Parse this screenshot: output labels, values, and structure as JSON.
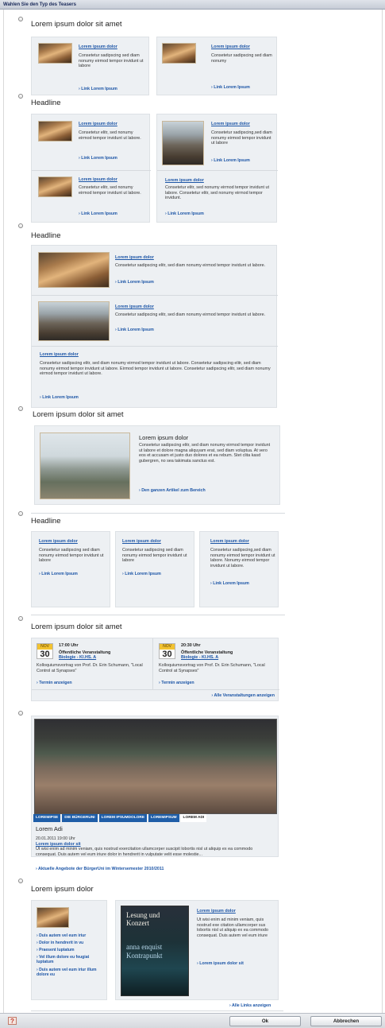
{
  "dialog": {
    "title": "Wahlen Sie den Typ des Teasers",
    "ok_label": "Ok",
    "cancel_label": "Abbrechen",
    "help_label": "?"
  },
  "sections": {
    "s1": {
      "title": "Lorem ipsum dolor sit amet",
      "cards": [
        {
          "link": "Lorem ipsum dolor",
          "text": "Consetetur sadipscing sed diam nonumy eirmod tempor invidunt ut labore",
          "more": "› Link Lorem Ipsum"
        },
        {
          "link": "Lorem ipsum dolor",
          "text": "Consetetur sadipscing sed diam nonumy",
          "more": "› Link Lorem Ipsum"
        }
      ]
    },
    "s2": {
      "title": "Headline",
      "cards": [
        {
          "link": "Lorem ipsum dolor",
          "text": "Consetetur elitr, sed nonumy eirmod tempor invidunt ut labore.",
          "more": "› Link Lorem Ipsum"
        },
        {
          "link": "Lorem ipsum dolor",
          "text": "Consetetur sadipscing,sed diam nonumy eirmod tempor invidunt ut labore",
          "more": "› Link Lorem Ipsum"
        },
        {
          "link": "Lorem ipsum dolor",
          "text": "Consetetur elitr, sed nonumy eirmod tempor invidunt ut labore.",
          "more": "› Link Lorem Ipsum"
        },
        {
          "link": "Lorem ipsum dolor",
          "text": "Consetetur elitr, sed nonumy eirmod tempor invidunt ut labore. Consetetur elitr, sed nonumy eirmod tempor invidunt.",
          "more": "› Link Lorem Ipsum"
        }
      ]
    },
    "s3": {
      "title": "Headline",
      "items": [
        {
          "link": "Lorem ipsum dolor",
          "text": "Consetetur sadipscing elitr, sed diam nonumy eirmod tempor invidunt ut labore.",
          "more": "› Link Lorem Ipsum"
        },
        {
          "link": "Lorem ipsum dolor",
          "text": "Consetetur sadipscing elitr, sed diam nonumy eirmod tempor invidunt ut labore.",
          "more": "› Link Lorem Ipsum"
        },
        {
          "link": "Lorem ipsum dolor",
          "text": "Consetetur sadipscing elitr, sed diam nonumy eirmod tempor invidunt ut labore. Consetetur sadipscing elitr, sed diam nonumy eirmod tempor invidunt ut labore. Eirmod tempor invidunt ut labore. Consetetur sadipscing elitr, sed diam nonumy eirmod tempor invidunt ut labore.",
          "more": "› Link Lorem Ipsum"
        }
      ]
    },
    "s4": {
      "title": "Lorem ipsum dolor sit amet",
      "heading": "Lorem ipsum dolor",
      "text": "Consetetur sadipscing elitr, sed diam nonumy eirmod tempor invidunt ut labore et dolore magna aliquyam erat, sed diam voluptua. At vero eos et accusam et justo duo dolores et ea rebum. Stet clita kasd gubergren, no sea takimata sanctus est.",
      "more": "› Den ganzen Artikel zum Bereich"
    },
    "s5": {
      "title": "Headline",
      "cards": [
        {
          "link": "Lorem ipsum dolor",
          "text": "Consetetur sadipscing sed diam nonumy eirmod tempor invidunt ut labore",
          "more": "› Link Lorem Ipsum"
        },
        {
          "link": "Lorem ipsum dolor",
          "text": "Consetetur sadipscing sed diam nonumy eirmod tempor invidunt ut labore",
          "more": "› Link Lorem Ipsum"
        },
        {
          "link": "Lorem ipsum dolor",
          "text": "Consetetur sadipscing,sed diam nonumy eirmod tempor invidunt ut labore. Nonumy eirmod tempor invidunt ut labore.",
          "more": "› Link Lorem Ipsum"
        }
      ]
    },
    "s6": {
      "title": "Lorem ipsum dolor sit amet",
      "events": [
        {
          "month": "NOV",
          "day": "30",
          "time": "17:00 Uhr",
          "type": "Öffentliche Veranstaltung",
          "link": "Biologie - KI.HS. A",
          "desc": "Kolloquiumsvortrag von Prof. Dr. Erin Schumann, \"Local Control at Synapses\"",
          "more": "› Termin anzeigen"
        },
        {
          "month": "NOV",
          "day": "30",
          "time": "20:30 Uhr",
          "type": "Öffentliche Veranstaltung",
          "link": "Biologie - KI.HS. A",
          "desc": "Kolloquiumsvortrag von Prof. Dr. Erin Schumann, \"Local Control at Synapses\"",
          "more": "› Termin anzeigen"
        }
      ],
      "all": "› Alle Veranstaltungen anzeigen"
    },
    "s7": {
      "tabs": [
        "LOREMIPSE",
        "DIE BÜRGERUNI",
        "LOREM IPSUMDOLORE",
        "LOREMIPSUM",
        "LOREM ADI"
      ],
      "heading": "Lorem Adi",
      "date": "20.01.2011 19:00 Uhr",
      "link": "Lorem ipsum dolor sit",
      "text": "Ut wisi enim ad minim veniam, quis nostrud exercitation ullamcorper suscipit lobortis nisl ut aliquip ex ea commodo consequat. Duis autem vel eum iriure dolor in hendrerit in vulputate velit esse molestie...",
      "more": "› Aktuelle Angebote der BürgerUni im Wintersemester 2010/2011"
    },
    "s8": {
      "title": "Lorem ipsum dolor",
      "bullets": [
        "› Duis autem vel eum iriur",
        "› Dolor in hendrerit in vu",
        "› Praesent luptatum",
        "› Vel illum dolore eu feugiat luptatum",
        "› Duis autem vel eum iriur illum dolore eu"
      ],
      "book_line1": "Lesung und",
      "book_line2": "Konzert",
      "book_author": "anna enquist",
      "book_title": "Kontrapunkt",
      "link": "Lorem ipsum dolor",
      "text": "Ut wisi enim ad minim veniam, quis nostrud exe citation ullamcorper sus lobortis nisl ut aliquip ex ea commodo consequat. Duis autem vel eum iriure",
      "more": "› Lorem ipsum dolor sit",
      "all": "› Alle Links anzeigen"
    }
  }
}
